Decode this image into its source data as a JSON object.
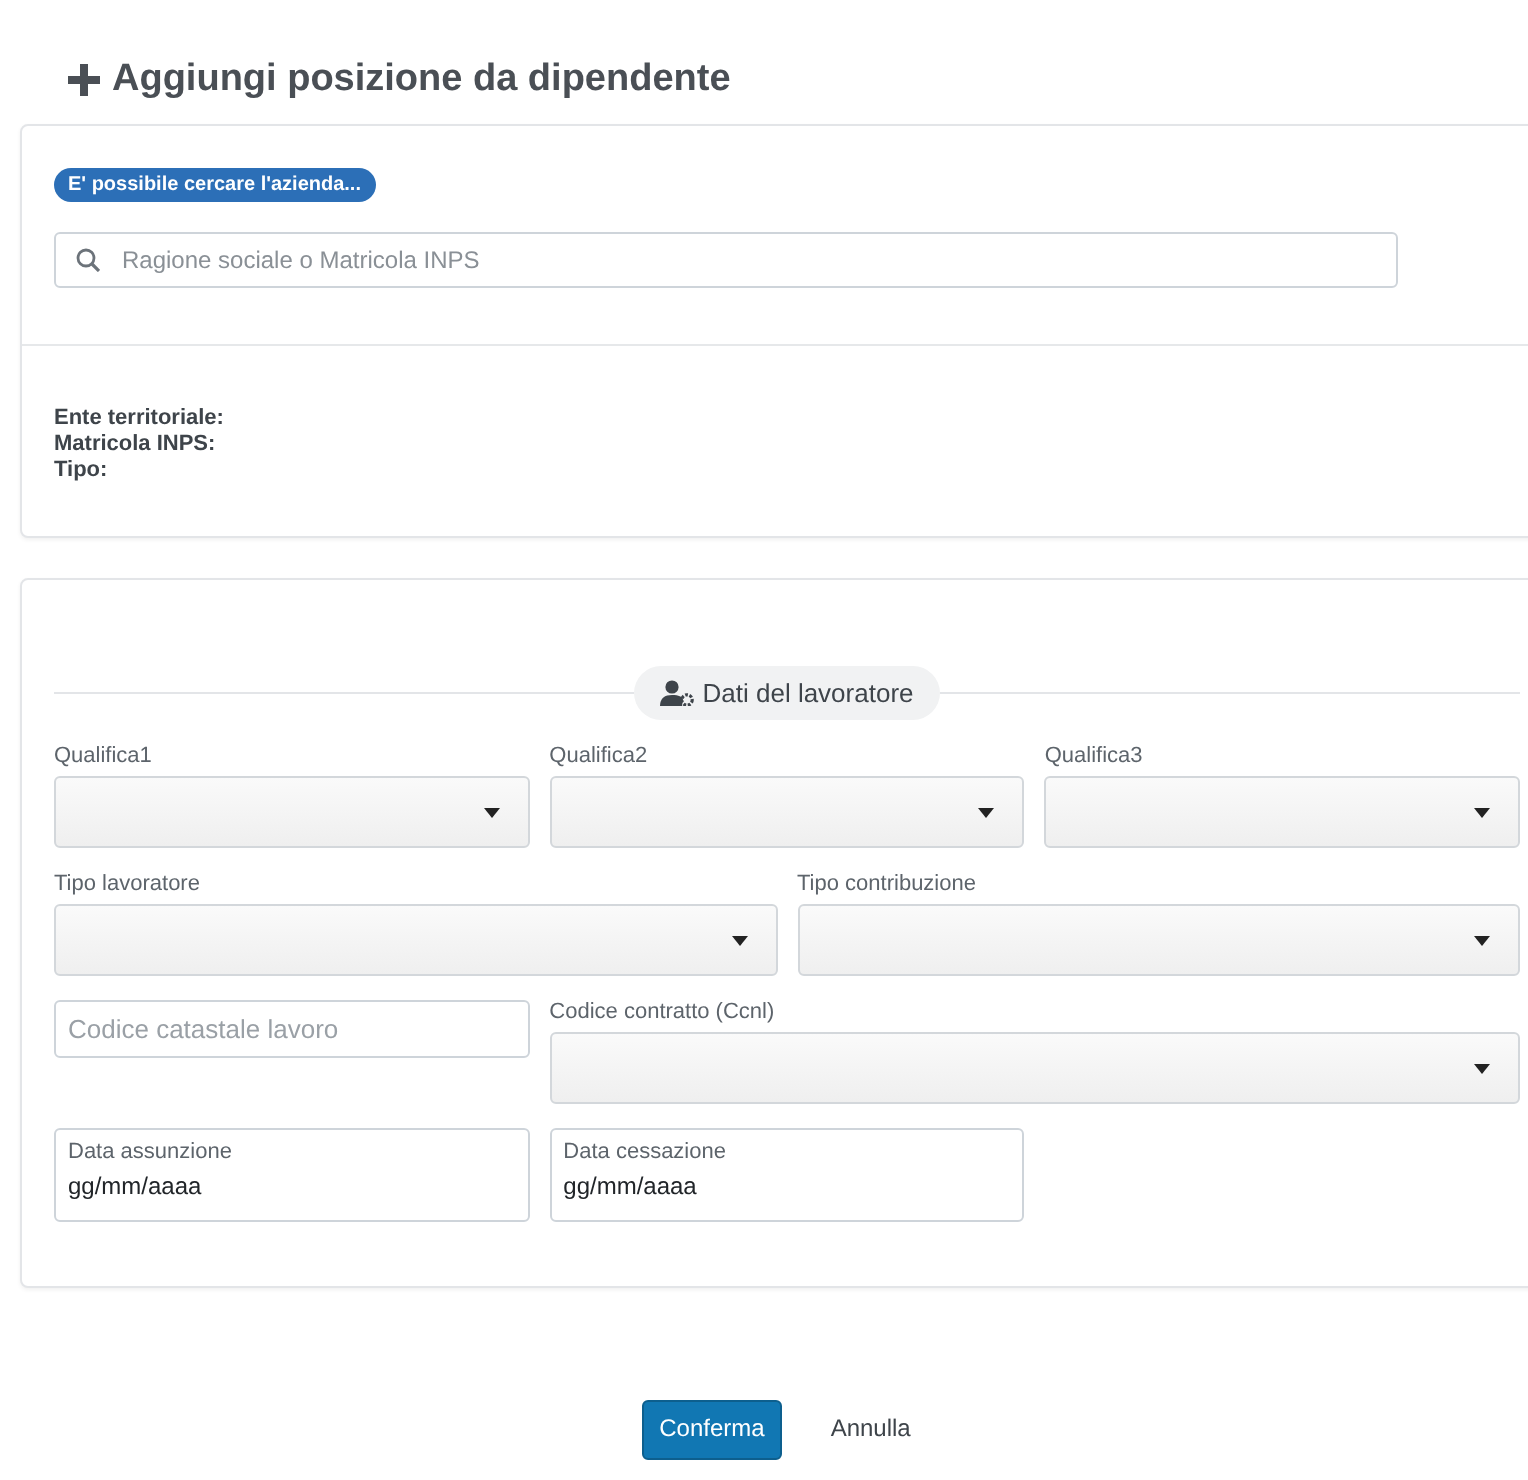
{
  "title": "Aggiungi posizione da dipendente",
  "search": {
    "badge": "E' possibile cercare l'azienda...",
    "placeholder": "Ragione sociale o Matricola INPS"
  },
  "info": [
    "Ente territoriale:",
    "Matricola INPS:",
    "Tipo:"
  ],
  "section": {
    "heading": "Dati del lavoratore"
  },
  "rows": [
    [
      {
        "kind": "select",
        "label": "Qualifica1"
      },
      {
        "kind": "select",
        "label": "Qualifica2"
      },
      {
        "kind": "select",
        "label": "Qualifica3"
      }
    ],
    [
      {
        "kind": "select",
        "label": "Tipo lavoratore"
      },
      {
        "kind": "select",
        "label": "Tipo contribuzione"
      }
    ],
    [
      {
        "kind": "input",
        "placeholder": "Codice catastale lavoro"
      },
      {
        "kind": "select",
        "label": "Codice contratto (Ccnl)"
      }
    ],
    [
      {
        "kind": "date",
        "label": "Data assunzione",
        "value": "gg/mm/aaaa"
      },
      {
        "kind": "date",
        "label": "Data cessazione",
        "value": "gg/mm/aaaa"
      }
    ]
  ],
  "buttons": [
    {
      "kind": "primary",
      "label": "Conferma"
    },
    {
      "kind": "link",
      "label": "Annulla"
    }
  ]
}
